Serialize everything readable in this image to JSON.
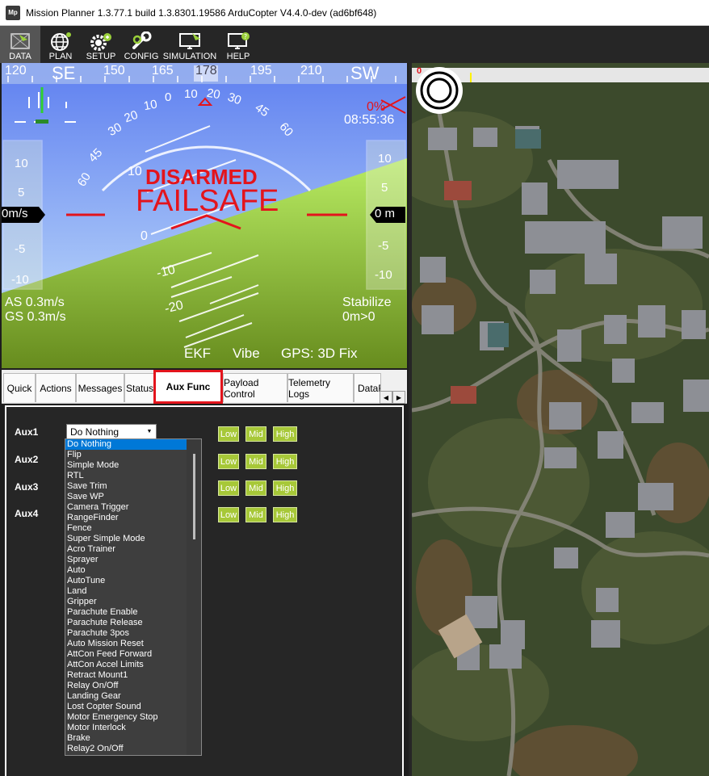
{
  "window": {
    "title": "Mission Planner 1.3.77.1 build 1.3.8301.19586 ArduCopter V4.4.0-dev (ad6bf648)",
    "app_icon_text": "Mp"
  },
  "menu": [
    {
      "label": "DATA",
      "icon": "data-icon"
    },
    {
      "label": "PLAN",
      "icon": "plan-globe-icon"
    },
    {
      "label": "SETUP",
      "icon": "setup-gears-icon"
    },
    {
      "label": "CONFIG",
      "icon": "config-wrench-icon"
    },
    {
      "label": "SIMULATION",
      "icon": "simulation-monitor-icon"
    },
    {
      "label": "HELP",
      "icon": "help-monitor-icon"
    }
  ],
  "hud": {
    "heading_ticks": [
      "120",
      "SE",
      "150",
      "165",
      "178",
      "195",
      "210",
      "SW"
    ],
    "pitch_labels_up": [
      "10",
      "0"
    ],
    "pitch_labels_down": [
      "-10",
      "-20"
    ],
    "roll_labels_left": [
      "60",
      "45",
      "30",
      "20",
      "10",
      "0"
    ],
    "roll_labels_right": [
      "10",
      "20",
      "30",
      "45",
      "60"
    ],
    "status_disarmed": "DISARMED",
    "status_failsafe": "FAILSAFE",
    "battery_pct": "0%",
    "clock": "08:55:36",
    "speed_tape": [
      "10",
      "5",
      "-5",
      "-10"
    ],
    "speed_value": "0m/s",
    "alt_tape": [
      "10",
      "5",
      "-5",
      "-10"
    ],
    "alt_value": "0 m",
    "airspeed": "AS 0.3m/s",
    "groundspeed": "GS 0.3m/s",
    "mode": "Stabilize",
    "wp_dist": "0m>0",
    "ekf": "EKF",
    "vibe": "Vibe",
    "gps": "GPS: 3D Fix"
  },
  "tabs": [
    "Quick",
    "Actions",
    "Messages",
    "Status",
    "Aux Func",
    "Payload Control",
    "Telemetry Logs",
    "DataF"
  ],
  "aux": {
    "rows": [
      "Aux1",
      "Aux2",
      "Aux3",
      "Aux4"
    ],
    "select_value": "Do Nothing",
    "levels": [
      "Low",
      "Mid",
      "High"
    ],
    "options": [
      "Do Nothing",
      "Flip",
      "Simple Mode",
      "RTL",
      "Save Trim",
      "Save WP",
      "Camera Trigger",
      "RangeFinder",
      "Fence",
      "Super Simple Mode",
      "Acro Trainer",
      "Sprayer",
      "Auto",
      "AutoTune",
      "Land",
      "Gripper",
      "Parachute Enable",
      "Parachute Release",
      "Parachute 3pos",
      "Auto Mission Reset",
      "AttCon Feed Forward",
      "AttCon Accel Limits",
      "Retract Mount1",
      "Relay On/Off",
      "Landing Gear",
      "Lost Copter Sound",
      "Motor Emergency Stop",
      "Motor Interlock",
      "Brake",
      "Relay2 On/Off"
    ]
  },
  "map": {
    "marker_zero": "0"
  }
}
